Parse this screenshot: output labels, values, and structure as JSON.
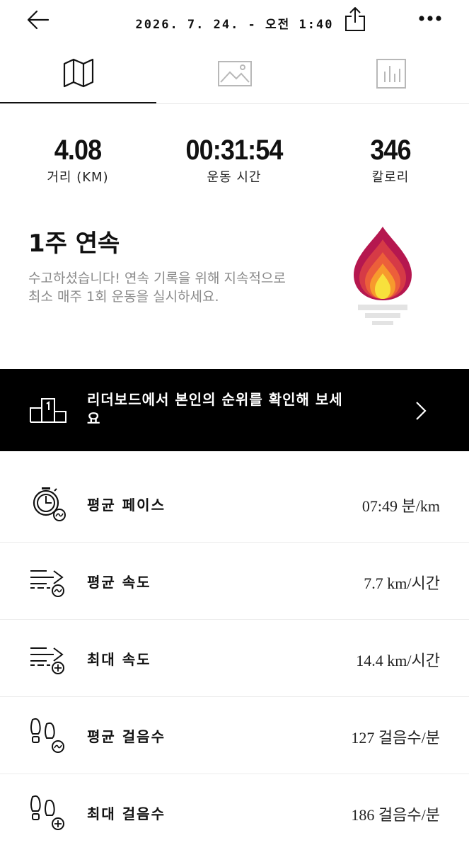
{
  "header": {
    "datetime": "2026. 7. 24. - 오전 1:40",
    "icons": {
      "back": "arrow-left-icon",
      "share": "share-icon",
      "more": "more-dots-icon"
    }
  },
  "tabs": [
    {
      "name": "map",
      "icon": "map-icon",
      "active": true
    },
    {
      "name": "photo",
      "icon": "image-icon",
      "active": false
    },
    {
      "name": "stats",
      "icon": "bar-chart-icon",
      "active": false
    }
  ],
  "summary": {
    "distance": {
      "value": "4.08",
      "label": "거리 (KM)"
    },
    "duration": {
      "value": "00:31:54",
      "label": "운동 시간"
    },
    "calories": {
      "value": "346",
      "label": "칼로리"
    }
  },
  "streak": {
    "title": "1주 연속",
    "description": "수고하셨습니다! 연속 기록을 위해 지속적으로 최소 매주 1회 운동을 실시하세요.",
    "flame_colors": [
      "#b5174f",
      "#d63a46",
      "#ec5f3a",
      "#f79a2d",
      "#f8e13c"
    ]
  },
  "leaderboard": {
    "text": "리더보드에서 본인의 순위를 확인해 보세요",
    "icon": "podium-icon"
  },
  "metrics": [
    {
      "label": "평균 페이스",
      "value": "07:49 분/km",
      "icon": "pace-timer-icon"
    },
    {
      "label": "평균 속도",
      "value": "7.7 km/시간",
      "icon": "speed-avg-icon"
    },
    {
      "label": "최대 속도",
      "value": "14.4 km/시간",
      "icon": "speed-max-icon"
    },
    {
      "label": "평균 걸음수",
      "value": "127 걸음수/분",
      "icon": "footsteps-avg-icon"
    },
    {
      "label": "최대 걸음수",
      "value": "186 걸음수/분",
      "icon": "footsteps-max-icon"
    }
  ]
}
